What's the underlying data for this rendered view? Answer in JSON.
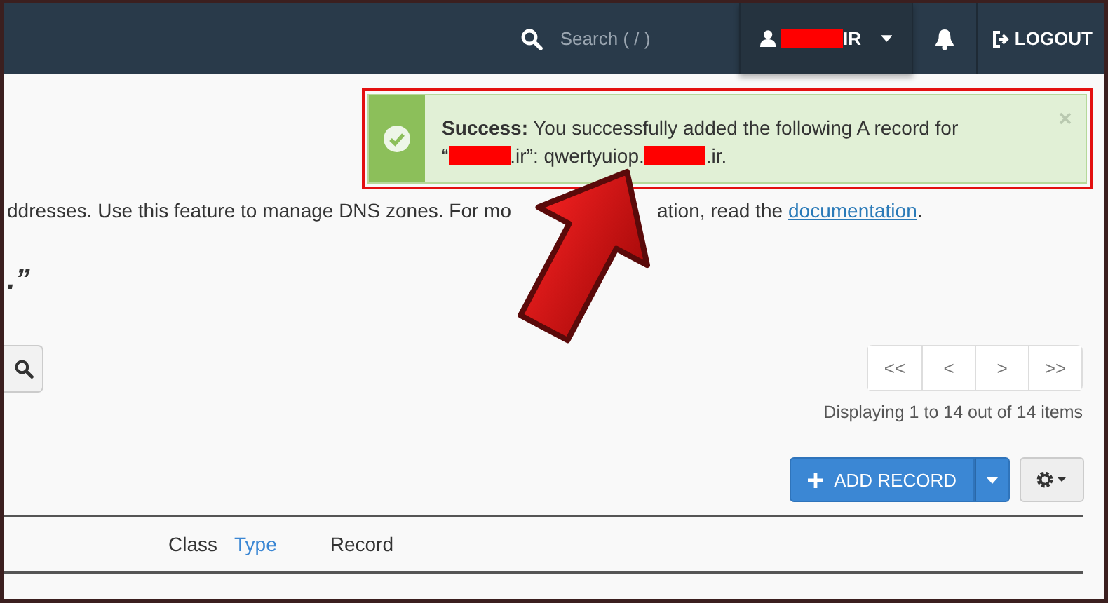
{
  "header": {
    "search": {
      "placeholder": "Search ( / )"
    },
    "user": {
      "name_redacted": true,
      "suffix": "IR"
    },
    "logout": "LOGOUT"
  },
  "alert": {
    "kind": "success",
    "highlighted": true,
    "lines": [
      [
        {
          "kind": "text",
          "text": "**Success:** You successfully added the following A record for"
        }
      ],
      [
        {
          "kind": "text",
          "text": "“"
        },
        {
          "kind": "redaction"
        },
        {
          "kind": "text",
          "text": ".ir”: qwertyuiop."
        },
        {
          "kind": "redaction"
        },
        {
          "kind": "text",
          "text": ".ir."
        }
      ]
    ]
  },
  "description": {
    "before": "ddresses. Use this feature to manage DNS zones. For mo",
    "after": "ation, read the",
    "link": "documentation",
    "end": "."
  },
  "heading": ".”",
  "pagination": [
    "<<",
    "<",
    ">",
    ">>"
  ],
  "summary": "Displaying 1 to 14 out of 14 items",
  "add_button": "ADD RECORD",
  "table": {
    "columns": [
      {
        "label": "Class",
        "sortable": false
      },
      {
        "label": "Type",
        "sortable": true
      },
      {
        "label": "Record",
        "sortable": false
      }
    ]
  }
}
